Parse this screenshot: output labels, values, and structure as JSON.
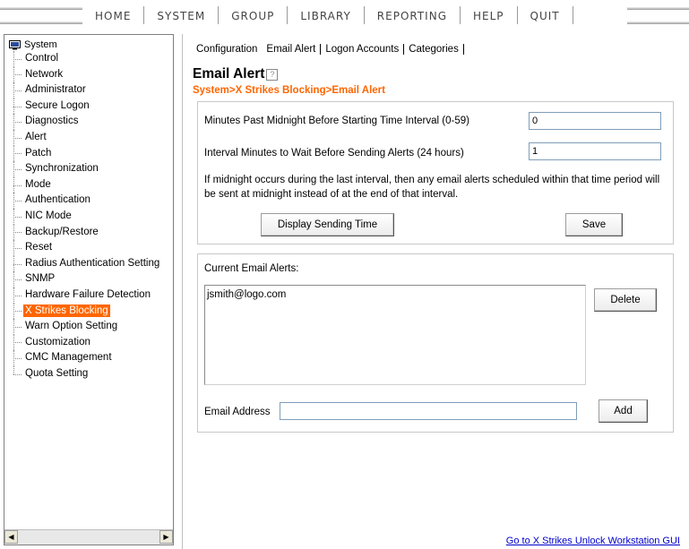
{
  "menu": {
    "items": [
      "HOME",
      "SYSTEM",
      "GROUP",
      "LIBRARY",
      "REPORTING",
      "HELP",
      "QUIT"
    ]
  },
  "tree": {
    "root_label": "System",
    "root_icon": "computer-icon",
    "selected": "X Strikes Blocking",
    "selected_color": "#ff6600",
    "items": [
      "Control",
      "Network",
      "Administrator",
      "Secure Logon",
      "Diagnostics",
      "Alert",
      "Patch",
      "Synchronization",
      "Mode",
      "Authentication",
      "NIC Mode",
      "Backup/Restore",
      "Reset",
      "Radius Authentication Setting",
      "SNMP",
      "Hardware Failure Detection",
      "X Strikes Blocking",
      "Warn Option Setting",
      "Customization",
      "CMC Management",
      "Quota Setting"
    ]
  },
  "tabs": [
    "Configuration",
    "Email Alert",
    "Logon Accounts",
    "Categories"
  ],
  "page": {
    "title": "Email Alert",
    "breadcrumb": "System>X Strikes Blocking>Email Alert",
    "breadcrumb_color": "#ff6600"
  },
  "settings": {
    "minutes_label": "Minutes Past Midnight Before Starting Time Interval (0-59)",
    "minutes_value": "0",
    "interval_label": "Interval Minutes to Wait Before Sending Alerts (24 hours)",
    "interval_value": "1",
    "note": "If midnight occurs during the last interval, then any email alerts scheduled within that time period will be sent at midnight instead of at the end of that interval.",
    "display_button": "Display Sending Time",
    "save_button": "Save"
  },
  "alerts": {
    "label": "Current Email Alerts:",
    "list": [
      "jsmith@logo.com"
    ],
    "delete_button": "Delete",
    "email_label": "Email Address",
    "email_value": "",
    "add_button": "Add"
  },
  "footer": {
    "link": "Go to X Strikes Unlock Workstation GUI",
    "link_color": "#0000cc"
  }
}
